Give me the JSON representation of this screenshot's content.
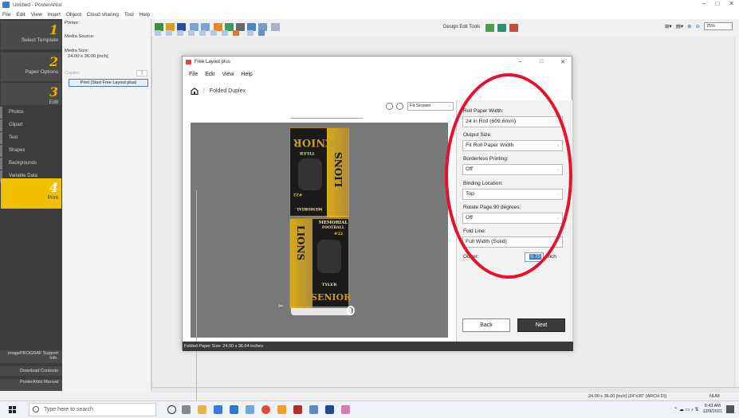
{
  "window": {
    "title": "Untitled - PosterArtist",
    "controls": [
      "–",
      "□",
      "✕"
    ]
  },
  "menu": [
    "File",
    "Edit",
    "View",
    "Insert",
    "Object",
    "Cloud sharing",
    "Tool",
    "Help"
  ],
  "steps": [
    {
      "num": "1",
      "label": "Select Template"
    },
    {
      "num": "2",
      "label": "Paper Options"
    },
    {
      "num": "3",
      "label": "Edit"
    },
    {
      "num": "4",
      "label": "Print"
    }
  ],
  "side_items": [
    "Photos",
    "Clipart",
    "Text",
    "Shapes",
    "Backgrounds",
    "Variable Data"
  ],
  "side_bottom": [
    "imagePROGRAF Support Info.",
    "Download Contents",
    "PosterArtist Manual"
  ],
  "settings": {
    "printer_label": "Printer:",
    "media_source_label": "Media Source:",
    "media_size_label": "Media Size:",
    "media_size_value": "24.00 x 36.00 [inch]",
    "copies_label": "Copies:",
    "copies_value": "1",
    "print_button": "Print (Start Free Layout plus)"
  },
  "toolbar": {
    "design_tools": "Design Edit Tools",
    "zoom_value": "75%"
  },
  "dialog": {
    "title": "Free Layout plus",
    "menu": [
      "File",
      "Edit",
      "View",
      "Help"
    ],
    "breadcrumb": "Folded Duplex",
    "fit": "Fit Screen",
    "footer": "Folded Paper Size: 24.00 x 36.64 inches",
    "fields": {
      "roll_label": "Roll Paper Width:",
      "roll_value": "24 in Roll (609.6mm)",
      "output_label": "Output Size:",
      "output_value": "Fit Roll Paper Width",
      "borderless_label": "Borderless Printing:",
      "borderless_value": "Off",
      "binding_label": "Binding Location:",
      "binding_value": "Top",
      "rotate_label": "Rotate Page 90 degrees:",
      "rotate_value": "Off",
      "fold_label": "Fold Line:",
      "fold_value": "Full Width (Solid)",
      "gutter_label": "Gutter:",
      "gutter_value": "0.75",
      "gutter_unit": "inch"
    },
    "back": "Back",
    "next": "Next"
  },
  "poster": {
    "top_word": "SENIOR",
    "side_word": "LIONS",
    "name": "TYLER",
    "number": "#22",
    "event": "MEMORIAL",
    "event_sub": "FOOTBALL"
  },
  "status": {
    "size": "24.00 x 36.00 [inch] (24\"x36\" (ARCH D))",
    "num": "NUM"
  },
  "taskbar": {
    "search_placeholder": "Type here to search",
    "time": "9:43 AM",
    "date": "12/9/2021"
  },
  "colors": {
    "highlight": "#e8112d",
    "accent": "#f0c000",
    "poster_gold": "#c79a2a"
  }
}
